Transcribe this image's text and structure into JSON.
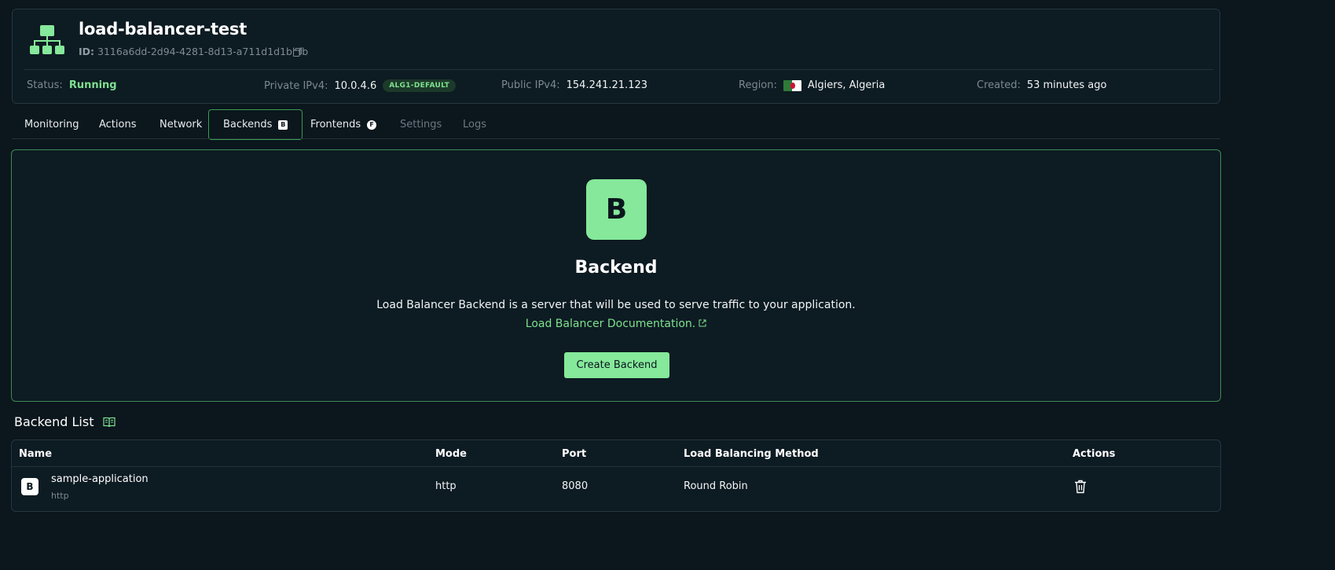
{
  "header": {
    "title": "load-balancer-test",
    "id_label": "ID:",
    "id_value": "3116a6dd-2d94-4281-8d13-a711d1d1bbfb",
    "icon": "load-balancer-icon",
    "status_label": "Status:",
    "status_value": "Running",
    "private_ipv4_label": "Private IPv4:",
    "private_ipv4_value": "10.0.4.6",
    "private_badge": "ALG1-DEFAULT",
    "public_ipv4_label": "Public IPv4:",
    "public_ipv4_value": "154.241.21.123",
    "region_label": "Region:",
    "region_value": "Algiers, Algeria",
    "created_label": "Created:",
    "created_value": "53 minutes ago"
  },
  "tabs": [
    {
      "label": "Monitoring",
      "state": "normal"
    },
    {
      "label": "Actions",
      "state": "normal"
    },
    {
      "label": "Network",
      "state": "normal"
    },
    {
      "label": "Backends",
      "state": "active",
      "badge": "B"
    },
    {
      "label": "Frontends",
      "state": "normal",
      "badge": "F"
    },
    {
      "label": "Settings",
      "state": "disabled"
    },
    {
      "label": "Logs",
      "state": "disabled"
    }
  ],
  "empty_state": {
    "icon_letter": "B",
    "title": "Backend",
    "description": "Load Balancer Backend is a server that will be used to serve traffic to your application.",
    "link_text": "Load Balancer Documentation.",
    "button_label": "Create Backend"
  },
  "backend_list": {
    "heading": "Backend List",
    "columns": [
      "Name",
      "Mode",
      "Port",
      "Load Balancing Method",
      "Actions"
    ],
    "rows": [
      {
        "badge": "B",
        "name": "sample-application",
        "subtitle": "http",
        "mode": "http",
        "port": "8080",
        "method": "Round Robin"
      }
    ]
  },
  "colors": {
    "background": "#0b161d",
    "accent": "#85e89a",
    "running": "#7fe08f",
    "border": "#27373f"
  }
}
